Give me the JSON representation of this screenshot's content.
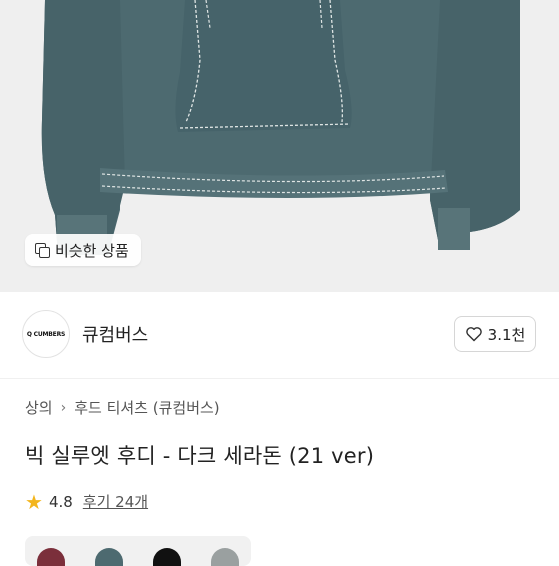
{
  "product_image": {
    "similar_button_label": "비슷한 상품",
    "hoodie_color": "#4d6a70"
  },
  "store": {
    "logo_text": "Q CUMBERS",
    "name": "큐컴버스",
    "likes": "3.1천"
  },
  "breadcrumb": [
    "상의",
    "후드 티셔츠 (큐컴버스)"
  ],
  "product": {
    "title": "빅 실루엣 후디 - 다크 세라돈 (21 ver)",
    "rating": "4.8",
    "reviews": "후기 24개"
  },
  "color_options": [
    "#7b2f3b",
    "#4d6a70",
    "#111111",
    "#9aa0a0"
  ],
  "colors": {
    "accent_star": "#f3b51c"
  }
}
